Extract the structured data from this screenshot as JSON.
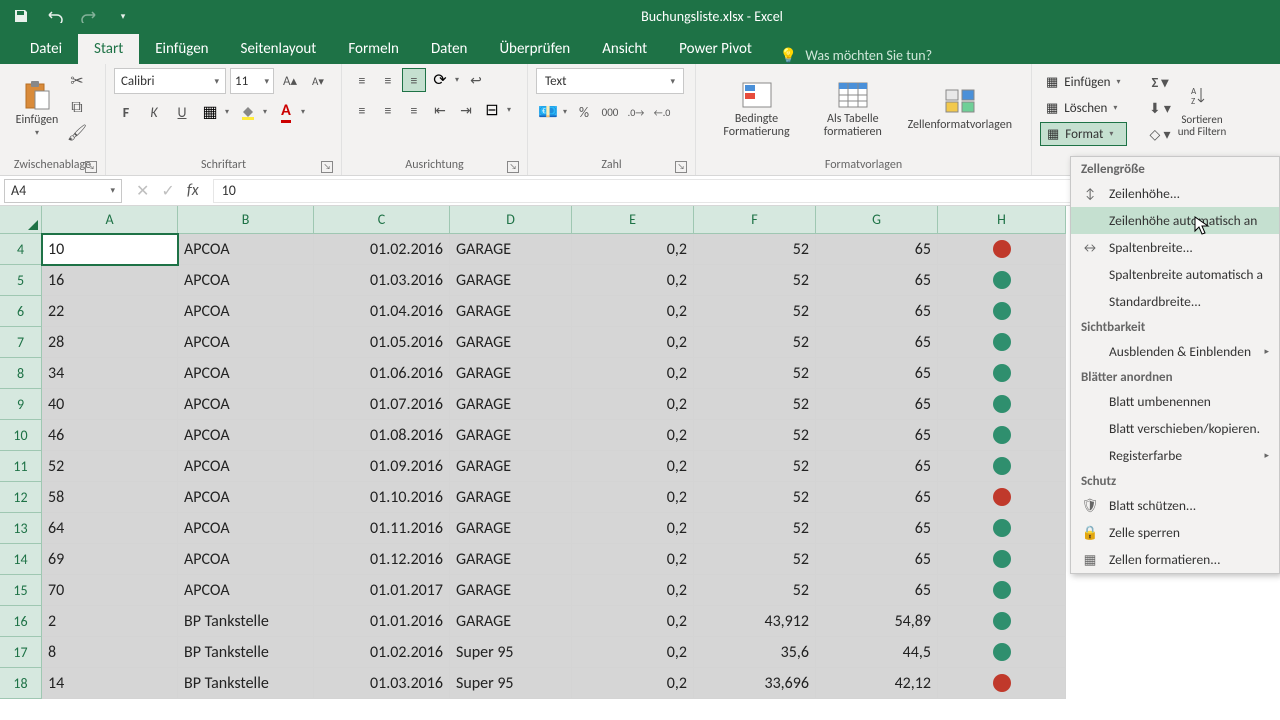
{
  "app": {
    "title": "Buchungsliste.xlsx - Excel"
  },
  "tabs": {
    "datei": "Datei",
    "start": "Start",
    "einfuegen": "Einfügen",
    "seitenlayout": "Seitenlayout",
    "formeln": "Formeln",
    "daten": "Daten",
    "ueberpruefen": "Überprüfen",
    "ansicht": "Ansicht",
    "powerpivot": "Power Pivot",
    "tellme": "Was möchten Sie tun?"
  },
  "ribbon": {
    "paste": "Einfügen",
    "clipboard": "Zwischenablage",
    "font_name": "Calibri",
    "font_size": "11",
    "font_group": "Schriftart",
    "alignment": "Ausrichtung",
    "number_format": "Text",
    "number_group": "Zahl",
    "cond_fmt": "Bedingte Formatierung",
    "as_table": "Als Tabelle formatieren",
    "cell_styles": "Zellenformatvorlagen",
    "styles_group": "Formatvorlagen",
    "insert": "Einfügen",
    "delete": "Löschen",
    "format": "Format",
    "sort_filter": "Sortieren und Filtern"
  },
  "formula_bar": {
    "name": "A4",
    "value": "10"
  },
  "columns": [
    "A",
    "B",
    "C",
    "D",
    "E",
    "F",
    "G",
    "H"
  ],
  "rows": [
    {
      "n": 4,
      "a": "10",
      "b": "APCOA",
      "c": "01.02.2016",
      "d": "GARAGE",
      "e": "0,2",
      "f": "52",
      "g": "65",
      "h": "red"
    },
    {
      "n": 5,
      "a": "16",
      "b": "APCOA",
      "c": "01.03.2016",
      "d": "GARAGE",
      "e": "0,2",
      "f": "52",
      "g": "65",
      "h": "green"
    },
    {
      "n": 6,
      "a": "22",
      "b": "APCOA",
      "c": "01.04.2016",
      "d": "GARAGE",
      "e": "0,2",
      "f": "52",
      "g": "65",
      "h": "green"
    },
    {
      "n": 7,
      "a": "28",
      "b": "APCOA",
      "c": "01.05.2016",
      "d": "GARAGE",
      "e": "0,2",
      "f": "52",
      "g": "65",
      "h": "green"
    },
    {
      "n": 8,
      "a": "34",
      "b": "APCOA",
      "c": "01.06.2016",
      "d": "GARAGE",
      "e": "0,2",
      "f": "52",
      "g": "65",
      "h": "green"
    },
    {
      "n": 9,
      "a": "40",
      "b": "APCOA",
      "c": "01.07.2016",
      "d": "GARAGE",
      "e": "0,2",
      "f": "52",
      "g": "65",
      "h": "green"
    },
    {
      "n": 10,
      "a": "46",
      "b": "APCOA",
      "c": "01.08.2016",
      "d": "GARAGE",
      "e": "0,2",
      "f": "52",
      "g": "65",
      "h": "green"
    },
    {
      "n": 11,
      "a": "52",
      "b": "APCOA",
      "c": "01.09.2016",
      "d": "GARAGE",
      "e": "0,2",
      "f": "52",
      "g": "65",
      "h": "green"
    },
    {
      "n": 12,
      "a": "58",
      "b": "APCOA",
      "c": "01.10.2016",
      "d": "GARAGE",
      "e": "0,2",
      "f": "52",
      "g": "65",
      "h": "red"
    },
    {
      "n": 13,
      "a": "64",
      "b": "APCOA",
      "c": "01.11.2016",
      "d": "GARAGE",
      "e": "0,2",
      "f": "52",
      "g": "65",
      "h": "green"
    },
    {
      "n": 14,
      "a": "69",
      "b": "APCOA",
      "c": "01.12.2016",
      "d": "GARAGE",
      "e": "0,2",
      "f": "52",
      "g": "65",
      "h": "green"
    },
    {
      "n": 15,
      "a": "70",
      "b": "APCOA",
      "c": "01.01.2017",
      "d": "GARAGE",
      "e": "0,2",
      "f": "52",
      "g": "65",
      "h": "green"
    },
    {
      "n": 16,
      "a": "2",
      "b": "BP Tankstelle",
      "c": "01.01.2016",
      "d": "GARAGE",
      "e": "0,2",
      "f": "43,912",
      "g": "54,89",
      "h": "green"
    },
    {
      "n": 17,
      "a": "8",
      "b": "BP Tankstelle",
      "c": "01.02.2016",
      "d": "Super 95",
      "e": "0,2",
      "f": "35,6",
      "g": "44,5",
      "h": "green"
    },
    {
      "n": 18,
      "a": "14",
      "b": "BP Tankstelle",
      "c": "01.03.2016",
      "d": "Super 95",
      "e": "0,2",
      "f": "33,696",
      "g": "42,12",
      "h": "red"
    }
  ],
  "format_menu": {
    "sec1": "Zellengröße",
    "row_height": "Zeilenhöhe...",
    "autofit_row": "Zeilenhöhe automatisch an",
    "col_width": "Spaltenbreite...",
    "autofit_col": "Spaltenbreite automatisch a",
    "default_width": "Standardbreite...",
    "sec2": "Sichtbarkeit",
    "hide_unhide": "Ausblenden & Einblenden",
    "sec3": "Blätter anordnen",
    "rename": "Blatt umbenennen",
    "move_copy": "Blatt verschieben/kopieren.",
    "tab_color": "Registerfarbe",
    "sec4": "Schutz",
    "protect": "Blatt schützen...",
    "lock_cell": "Zelle sperren",
    "format_cells": "Zellen formatieren..."
  }
}
